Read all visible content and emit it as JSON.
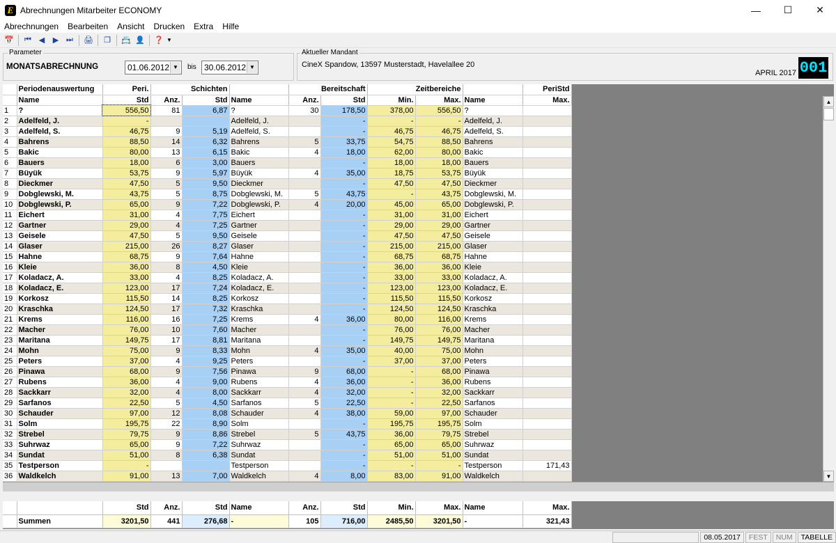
{
  "window": {
    "title": "Abrechnungen Mitarbeiter ECONOMY",
    "logo_letter": "E"
  },
  "menu": [
    "Abrechnungen",
    "Bearbeiten",
    "Ansicht",
    "Drucken",
    "Extra",
    "Hilfe"
  ],
  "parameter": {
    "label": "Parameter",
    "name": "MONATSABRECHNUNG",
    "date_from": "01.06.2012",
    "bis": "bis",
    "date_to": "30.06.2012"
  },
  "mandant": {
    "label": "Aktueller Mandant",
    "value": "CineX Spandow, 13597 Musterstadt, Havelallee 20",
    "period": "APRIL 2017",
    "code": "001"
  },
  "header": {
    "row1": [
      "Periodenauswertung",
      "Peri.",
      "Schichten",
      "Bereitschaft",
      "Zeitbereiche",
      "PeriStd"
    ],
    "row2": [
      "Name",
      "Std",
      "Anz.",
      "Std",
      "Name",
      "Anz.",
      "Std",
      "Min.",
      "Max.",
      "Name",
      "Max."
    ]
  },
  "rows": [
    [
      "1",
      "?",
      "556,50",
      "81",
      "6,87",
      "?",
      "30",
      "178,50",
      "378,00",
      "556,50",
      "?",
      ""
    ],
    [
      "2",
      "Adelfeld, J.",
      "-",
      "",
      "",
      "Adelfeld, J.",
      "",
      "-",
      "-",
      "-",
      "Adelfeld, J.",
      ""
    ],
    [
      "3",
      "Adelfeld, S.",
      "46,75",
      "9",
      "5,19",
      "Adelfeld, S.",
      "",
      "-",
      "46,75",
      "46,75",
      "Adelfeld, S.",
      ""
    ],
    [
      "4",
      "Bahrens",
      "88,50",
      "14",
      "6,32",
      "Bahrens",
      "5",
      "33,75",
      "54,75",
      "88,50",
      "Bahrens",
      ""
    ],
    [
      "5",
      "Bakic",
      "80,00",
      "13",
      "6,15",
      "Bakic",
      "4",
      "18,00",
      "62,00",
      "80,00",
      "Bakic",
      ""
    ],
    [
      "6",
      "Bauers",
      "18,00",
      "6",
      "3,00",
      "Bauers",
      "",
      "-",
      "18,00",
      "18,00",
      "Bauers",
      ""
    ],
    [
      "7",
      "Büyük",
      "53,75",
      "9",
      "5,97",
      "Büyük",
      "4",
      "35,00",
      "18,75",
      "53,75",
      "Büyük",
      ""
    ],
    [
      "8",
      "Dieckmer",
      "47,50",
      "5",
      "9,50",
      "Dieckmer",
      "",
      "-",
      "47,50",
      "47,50",
      "Dieckmer",
      ""
    ],
    [
      "9",
      "Dobglewski, M.",
      "43,75",
      "5",
      "8,75",
      "Dobglewski, M.",
      "5",
      "43,75",
      "-",
      "43,75",
      "Dobglewski, M.",
      ""
    ],
    [
      "10",
      "Dobglewski, P.",
      "65,00",
      "9",
      "7,22",
      "Dobglewski, P.",
      "4",
      "20,00",
      "45,00",
      "65,00",
      "Dobglewski, P.",
      ""
    ],
    [
      "11",
      "Eichert",
      "31,00",
      "4",
      "7,75",
      "Eichert",
      "",
      "-",
      "31,00",
      "31,00",
      "Eichert",
      ""
    ],
    [
      "12",
      "Gartner",
      "29,00",
      "4",
      "7,25",
      "Gartner",
      "",
      "-",
      "29,00",
      "29,00",
      "Gartner",
      ""
    ],
    [
      "13",
      "Geisele",
      "47,50",
      "5",
      "9,50",
      "Geisele",
      "",
      "-",
      "47,50",
      "47,50",
      "Geisele",
      ""
    ],
    [
      "14",
      "Glaser",
      "215,00",
      "26",
      "8,27",
      "Glaser",
      "",
      "-",
      "215,00",
      "215,00",
      "Glaser",
      ""
    ],
    [
      "15",
      "Hahne",
      "68,75",
      "9",
      "7,64",
      "Hahne",
      "",
      "-",
      "68,75",
      "68,75",
      "Hahne",
      ""
    ],
    [
      "16",
      "Kleie",
      "36,00",
      "8",
      "4,50",
      "Kleie",
      "",
      "-",
      "36,00",
      "36,00",
      "Kleie",
      ""
    ],
    [
      "17",
      "Koladacz, A.",
      "33,00",
      "4",
      "8,25",
      "Koladacz, A.",
      "",
      "-",
      "33,00",
      "33,00",
      "Koladacz, A.",
      ""
    ],
    [
      "18",
      "Koladacz, E.",
      "123,00",
      "17",
      "7,24",
      "Koladacz, E.",
      "",
      "-",
      "123,00",
      "123,00",
      "Koladacz, E.",
      ""
    ],
    [
      "19",
      "Korkosz",
      "115,50",
      "14",
      "8,25",
      "Korkosz",
      "",
      "-",
      "115,50",
      "115,50",
      "Korkosz",
      ""
    ],
    [
      "20",
      "Kraschka",
      "124,50",
      "17",
      "7,32",
      "Kraschka",
      "",
      "-",
      "124,50",
      "124,50",
      "Kraschka",
      ""
    ],
    [
      "21",
      "Krems",
      "116,00",
      "16",
      "7,25",
      "Krems",
      "4",
      "36,00",
      "80,00",
      "116,00",
      "Krems",
      ""
    ],
    [
      "22",
      "Macher",
      "76,00",
      "10",
      "7,60",
      "Macher",
      "",
      "-",
      "76,00",
      "76,00",
      "Macher",
      ""
    ],
    [
      "23",
      "Maritana",
      "149,75",
      "17",
      "8,81",
      "Maritana",
      "",
      "-",
      "149,75",
      "149,75",
      "Maritana",
      ""
    ],
    [
      "24",
      "Mohn",
      "75,00",
      "9",
      "8,33",
      "Mohn",
      "4",
      "35,00",
      "40,00",
      "75,00",
      "Mohn",
      ""
    ],
    [
      "25",
      "Peters",
      "37,00",
      "4",
      "9,25",
      "Peters",
      "",
      "-",
      "37,00",
      "37,00",
      "Peters",
      ""
    ],
    [
      "26",
      "Pinawa",
      "68,00",
      "9",
      "7,56",
      "Pinawa",
      "9",
      "68,00",
      "-",
      "68,00",
      "Pinawa",
      ""
    ],
    [
      "27",
      "Rubens",
      "36,00",
      "4",
      "9,00",
      "Rubens",
      "4",
      "36,00",
      "-",
      "36,00",
      "Rubens",
      ""
    ],
    [
      "28",
      "Sackkarr",
      "32,00",
      "4",
      "8,00",
      "Sackkarr",
      "4",
      "32,00",
      "-",
      "32,00",
      "Sackkarr",
      ""
    ],
    [
      "29",
      "Sarfanos",
      "22,50",
      "5",
      "4,50",
      "Sarfanos",
      "5",
      "22,50",
      "-",
      "22,50",
      "Sarfanos",
      ""
    ],
    [
      "30",
      "Schauder",
      "97,00",
      "12",
      "8,08",
      "Schauder",
      "4",
      "38,00",
      "59,00",
      "97,00",
      "Schauder",
      ""
    ],
    [
      "31",
      "Solm",
      "195,75",
      "22",
      "8,90",
      "Solm",
      "",
      "-",
      "195,75",
      "195,75",
      "Solm",
      ""
    ],
    [
      "32",
      "Strebel",
      "79,75",
      "9",
      "8,86",
      "Strebel",
      "5",
      "43,75",
      "36,00",
      "79,75",
      "Strebel",
      ""
    ],
    [
      "33",
      "Suhrwaz",
      "65,00",
      "9",
      "7,22",
      "Suhrwaz",
      "",
      "-",
      "65,00",
      "65,00",
      "Suhrwaz",
      ""
    ],
    [
      "34",
      "Sundat",
      "51,00",
      "8",
      "6,38",
      "Sundat",
      "",
      "-",
      "51,00",
      "51,00",
      "Sundat",
      ""
    ],
    [
      "35",
      "Testperson",
      "-",
      "",
      "",
      "Testperson",
      "",
      "-",
      "-",
      "-",
      "Testperson",
      "171,43"
    ],
    [
      "36",
      "Waldkelch",
      "91,00",
      "13",
      "7,00",
      "Waldkelch",
      "4",
      "8,00",
      "83,00",
      "91,00",
      "Waldkelch",
      ""
    ]
  ],
  "summary": {
    "header": [
      "Std",
      "Anz.",
      "Std",
      "Name",
      "Anz.",
      "Std",
      "Min.",
      "Max.",
      "Name",
      "Max."
    ],
    "label": "Summen",
    "values": [
      "3201,50",
      "441",
      "276,68",
      "-",
      "105",
      "716,00",
      "2485,50",
      "3201,50",
      "-",
      "321,43"
    ]
  },
  "status": {
    "date": "08.05.2017",
    "fest": "FEST",
    "num": "NUM",
    "mode": "TABELLE"
  }
}
